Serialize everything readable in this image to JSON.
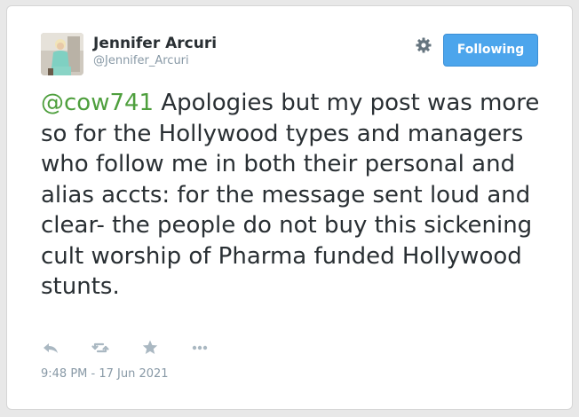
{
  "author": {
    "display_name": "Jennifer Arcuri",
    "handle": "@Jennifer_Arcuri"
  },
  "header": {
    "follow_label": "Following",
    "settings_icon": "gear-icon"
  },
  "tweet": {
    "mention": "@cow741",
    "text": " Apologies but my post was more so for the Hollywood types and managers who follow me in both their personal and alias accts: for the message sent loud and clear- the people do not buy this sickening cult worship of Pharma funded Hollywood stunts."
  },
  "actions": [
    "reply-icon",
    "retweet-icon",
    "favorite-icon",
    "more-icon"
  ],
  "timestamp": "9:48 PM - 17 Jun 2021",
  "colors": {
    "accent_button": "#4ca5ec",
    "mention": "#4e9f3d",
    "muted": "#8899a6",
    "text": "#292f33"
  }
}
